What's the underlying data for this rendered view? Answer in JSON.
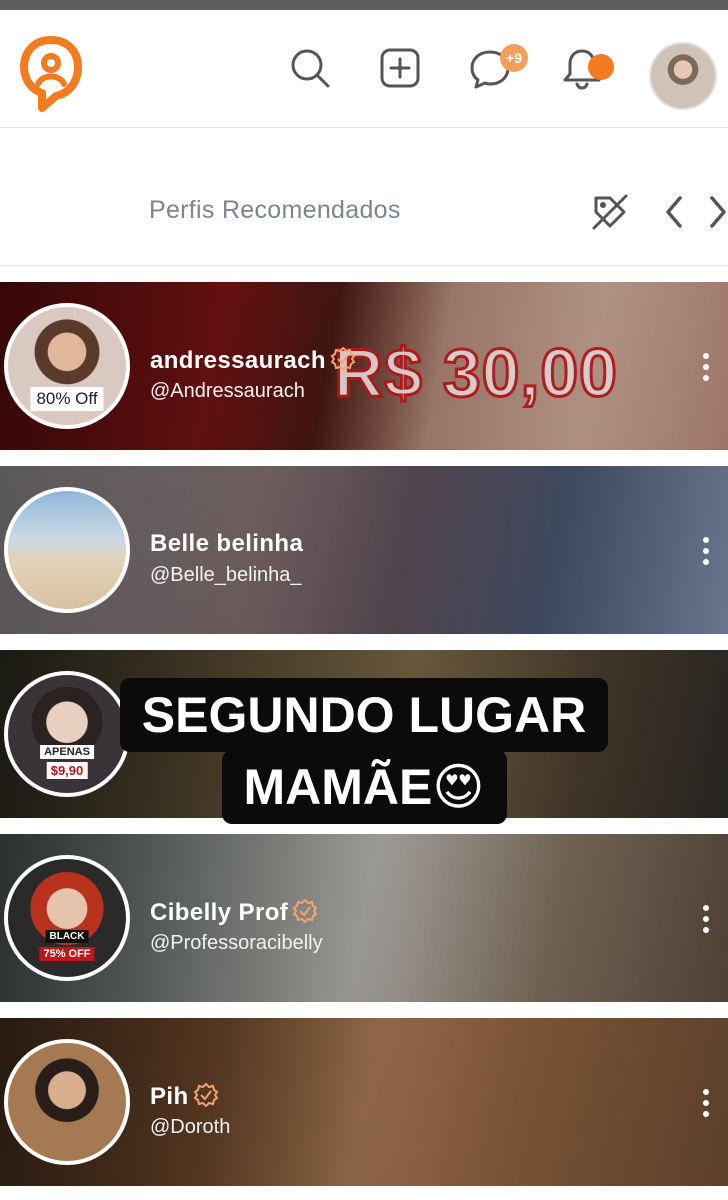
{
  "header": {
    "message_badge": "+9",
    "icons": [
      "logo-icon",
      "search-icon",
      "add-post-icon",
      "chat-icon",
      "bell-icon",
      "user-avatar"
    ]
  },
  "recommended": {
    "title": "Perfis Recomendados"
  },
  "profiles": [
    {
      "name": "andressaurach",
      "handle": "@Andressaurach",
      "verified": true,
      "avatar_badge": "80% Off",
      "banner_text": "R$ 30,00"
    },
    {
      "name": "Belle belinha",
      "handle": "@Belle_belinha_",
      "verified": false
    },
    {
      "name": "",
      "handle": "",
      "verified": false,
      "avatar_badge_top": "APENAS",
      "avatar_badge_bottom": "$9,90"
    },
    {
      "name": "Cibelly Prof",
      "handle": "@Professoracibelly",
      "verified": true,
      "avatar_badge_top": "BLACK",
      "avatar_badge_bottom": "75% OFF"
    },
    {
      "name": "Pih",
      "handle": "@Doroth",
      "verified": true
    }
  ],
  "overlay_caption": {
    "line1": "SEGUNDO LUGAR",
    "line2": "MAMÃE😍"
  },
  "colors": {
    "accent": "#f47c20",
    "verified": "#f3a36b",
    "text_muted": "#7c8591"
  }
}
